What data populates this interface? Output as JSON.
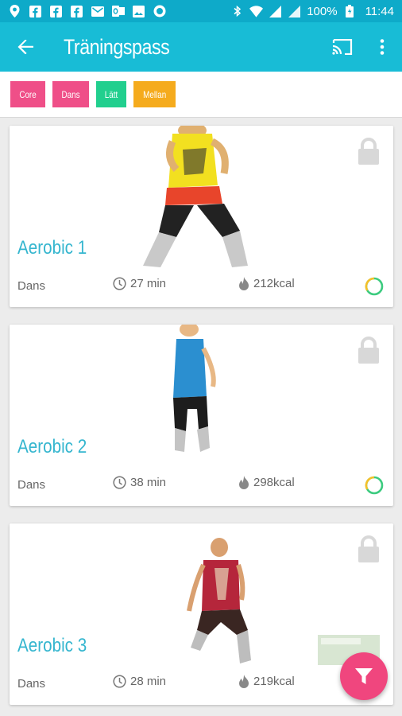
{
  "status_bar": {
    "battery": "100%",
    "time": "11:44",
    "left_icons": [
      "location-icon",
      "facebook-icon",
      "facebook-icon",
      "facebook-icon",
      "mail-icon",
      "outlook-icon",
      "image-icon",
      "circle-icon"
    ],
    "right_icons": [
      "bluetooth-icon",
      "wifi-icon",
      "signal-icon",
      "battery-icon"
    ]
  },
  "app_bar": {
    "title": "Träningspass",
    "back_icon": "arrow-back-icon",
    "cast_icon": "cast-icon",
    "menu_icon": "more-vert-icon"
  },
  "filters": [
    {
      "label": "Core",
      "color": "#ef4f88"
    },
    {
      "label": "Dans",
      "color": "#ef4f88"
    },
    {
      "label": "Lätt",
      "color": "#21cf8e"
    },
    {
      "label": "Mellan",
      "color": "#f5ab1d"
    }
  ],
  "workouts": [
    {
      "title": "Aerobic 1",
      "category": "Dans",
      "duration": "27 min",
      "calories": "212kcal",
      "locked": true,
      "progress": 0.35
    },
    {
      "title": "Aerobic 2",
      "category": "Dans",
      "duration": "38 min",
      "calories": "298kcal",
      "locked": true,
      "progress": 0.35
    },
    {
      "title": "Aerobic 3",
      "category": "Dans",
      "duration": "28 min",
      "calories": "219kcal",
      "locked": true,
      "progress": 0.35
    }
  ],
  "colors": {
    "primary": "#18bcd6",
    "status_bar": "#0eaac9",
    "accent": "#f0467e",
    "title_text": "#35b6cf",
    "progress_green": "#3ccb7f",
    "progress_yellow": "#f5c02a"
  },
  "fab": {
    "icon": "filter-icon"
  }
}
